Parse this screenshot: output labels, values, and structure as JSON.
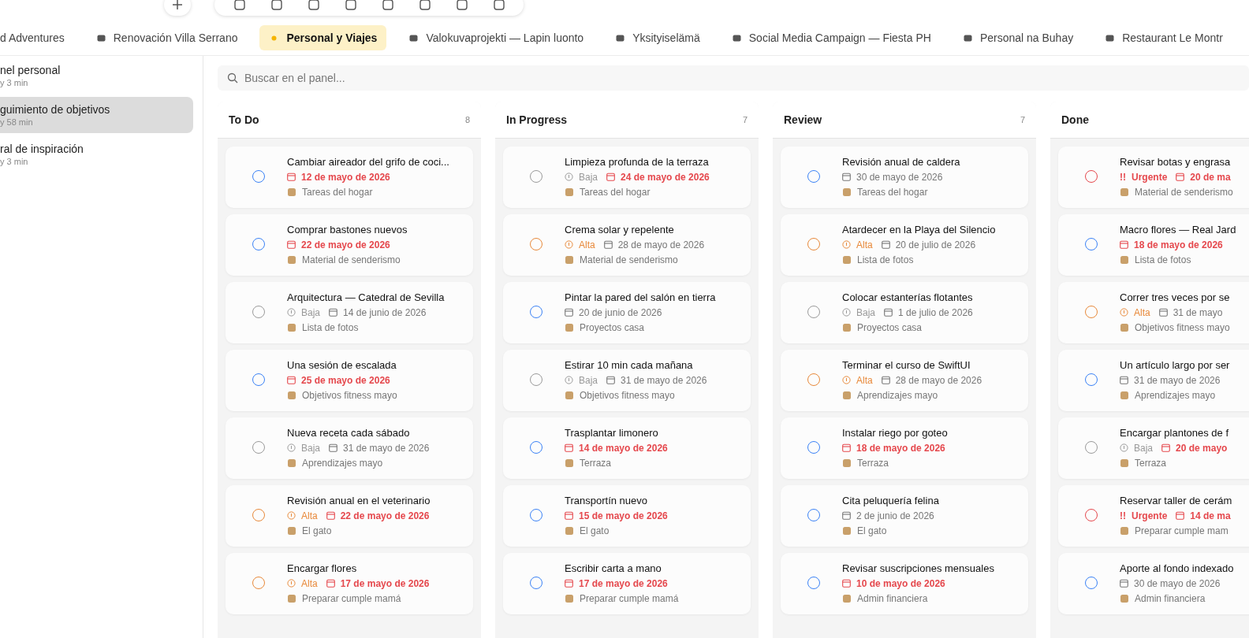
{
  "tabs": [
    {
      "label": "d Adventures",
      "selected": false
    },
    {
      "label": "Renovación Villa Serrano",
      "selected": false
    },
    {
      "label": "Personal y Viajes",
      "selected": true
    },
    {
      "label": "Valokuvaprojekti — Lapin luonto",
      "selected": false
    },
    {
      "label": "Yksityiselämä",
      "selected": false
    },
    {
      "label": "Social Media Campaign — Fiesta PH",
      "selected": false
    },
    {
      "label": "Personal na Buhay",
      "selected": false
    },
    {
      "label": "Restaurant Le Montr",
      "selected": false
    }
  ],
  "sidebar": {
    "items": [
      {
        "title": "nel personal",
        "subtitle": "y 3 min",
        "selected": false
      },
      {
        "title": "guimiento de objetivos",
        "subtitle": "y 58 min",
        "selected": true
      },
      {
        "title": "ral de inspiración",
        "subtitle": "y 3 min",
        "selected": false
      }
    ]
  },
  "search": {
    "placeholder": "Buscar en el panel..."
  },
  "columns": [
    {
      "title": "To Do",
      "count": "8",
      "cards": [
        {
          "checked": false,
          "title": "Cambiar aireador del grifo de coci...",
          "date": "12 de mayo de 2026",
          "overdue": true,
          "list": "Tareas del hogar"
        },
        {
          "checked": false,
          "title": "Comprar bastones nuevos",
          "date": "22 de mayo de 2026",
          "overdue": true,
          "list": "Material de senderismo"
        },
        {
          "checked": false,
          "title": "Arquitectura — Catedral de Sevilla",
          "priority": {
            "kind": "baja",
            "label": "Baja"
          },
          "date": "14 de junio de 2026",
          "overdue": false,
          "list": "Lista de fotos"
        },
        {
          "checked": false,
          "title": "Una sesión de escalada",
          "date": "25 de mayo de 2026",
          "overdue": true,
          "list": "Objetivos fitness mayo"
        },
        {
          "checked": false,
          "title": "Nueva receta cada sábado",
          "priority": {
            "kind": "baja",
            "label": "Baja"
          },
          "date": "31 de mayo de 2026",
          "overdue": false,
          "list": "Aprendizajes mayo"
        },
        {
          "checked": false,
          "title": "Revisión anual en el veterinario",
          "priority": {
            "kind": "alta",
            "label": "Alta"
          },
          "date": "22 de mayo de 2026",
          "overdue": true,
          "list": "El gato"
        },
        {
          "checked": false,
          "title": "Encargar flores",
          "priority": {
            "kind": "alta",
            "label": "Alta"
          },
          "date": "17 de mayo de 2026",
          "overdue": true,
          "list": "Preparar cumple mamá"
        }
      ]
    },
    {
      "title": "In Progress",
      "count": "7",
      "cards": [
        {
          "checked": false,
          "title": "Limpieza profunda de la terraza",
          "priority": {
            "kind": "baja",
            "label": "Baja"
          },
          "date": "24 de mayo de 2026",
          "overdue": true,
          "list": "Tareas del hogar"
        },
        {
          "checked": false,
          "title": "Crema solar y repelente",
          "priority": {
            "kind": "alta",
            "label": "Alta"
          },
          "date": "28 de mayo de 2026",
          "overdue": false,
          "list": "Material de senderismo"
        },
        {
          "checked": false,
          "title": "Pintar la pared del salón en tierra",
          "date": "20 de junio de 2026",
          "overdue": false,
          "list": "Proyectos casa"
        },
        {
          "checked": false,
          "title": "Estirar 10 min cada mañana",
          "priority": {
            "kind": "baja",
            "label": "Baja"
          },
          "date": "31 de mayo de 2026",
          "overdue": false,
          "list": "Objetivos fitness mayo"
        },
        {
          "checked": false,
          "title": "Trasplantar limonero",
          "date": "14 de mayo de 2026",
          "overdue": true,
          "list": "Terraza"
        },
        {
          "checked": false,
          "title": "Transportín nuevo",
          "date": "15 de mayo de 2026",
          "overdue": true,
          "list": "El gato"
        },
        {
          "checked": false,
          "title": "Escribir carta a mano",
          "date": "17 de mayo de 2026",
          "overdue": true,
          "list": "Preparar cumple mamá"
        }
      ]
    },
    {
      "title": "Review",
      "count": "7",
      "cards": [
        {
          "checked": false,
          "title": "Revisión anual de caldera",
          "date": "30 de mayo de 2026",
          "overdue": false,
          "list": "Tareas del hogar"
        },
        {
          "checked": false,
          "title": "Atardecer en la Playa del Silencio",
          "priority": {
            "kind": "alta",
            "label": "Alta"
          },
          "date": "20 de julio de 2026",
          "overdue": false,
          "list": "Lista de fotos"
        },
        {
          "checked": false,
          "title": "Colocar estanterías flotantes",
          "priority": {
            "kind": "baja",
            "label": "Baja"
          },
          "date": "1 de julio de 2026",
          "overdue": false,
          "list": "Proyectos casa"
        },
        {
          "checked": false,
          "title": "Terminar el curso de SwiftUI",
          "priority": {
            "kind": "alta",
            "label": "Alta"
          },
          "date": "28 de mayo de 2026",
          "overdue": false,
          "list": "Aprendizajes mayo"
        },
        {
          "checked": false,
          "title": "Instalar riego por goteo",
          "date": "18 de mayo de 2026",
          "overdue": true,
          "list": "Terraza"
        },
        {
          "checked": false,
          "title": "Cita peluquería felina",
          "date": "2 de junio de 2026",
          "overdue": false,
          "list": "El gato"
        },
        {
          "checked": false,
          "title": "Revisar suscripciones mensuales",
          "date": "10 de mayo de 2026",
          "overdue": true,
          "list": "Admin financiera"
        }
      ]
    },
    {
      "title": "Done",
      "cards": [
        {
          "checked": false,
          "title": "Revisar botas y engrasa",
          "priority": {
            "kind": "urgente",
            "mark": "!!",
            "label": "Urgente"
          },
          "date": "20 de ma",
          "overdue": true,
          "list": "Material de senderismo"
        },
        {
          "checked": false,
          "title": "Macro flores — Real Jard",
          "date": "18 de mayo de 2026",
          "overdue": true,
          "list": "Lista de fotos"
        },
        {
          "checked": false,
          "title": "Correr tres veces por se",
          "priority": {
            "kind": "alta",
            "label": "Alta"
          },
          "date": "31 de mayo",
          "overdue": false,
          "list": "Objetivos fitness mayo"
        },
        {
          "checked": false,
          "title": "Un artículo largo por ser",
          "date": "31 de mayo de 2026",
          "overdue": false,
          "list": "Aprendizajes mayo"
        },
        {
          "checked": false,
          "title": "Encargar plantones de f",
          "priority": {
            "kind": "baja",
            "label": "Baja"
          },
          "date": "20 de mayo",
          "overdue": true,
          "list": "Terraza"
        },
        {
          "checked": false,
          "title": "Reservar taller de cerám",
          "priority": {
            "kind": "urgente",
            "mark": "!!",
            "label": "Urgente"
          },
          "date": "14 de ma",
          "overdue": true,
          "list": "Preparar cumple mam"
        },
        {
          "checked": false,
          "title": "Aporte al fondo indexado",
          "date": "30 de mayo de 2026",
          "overdue": false,
          "list": "Admin financiera"
        }
      ]
    }
  ]
}
